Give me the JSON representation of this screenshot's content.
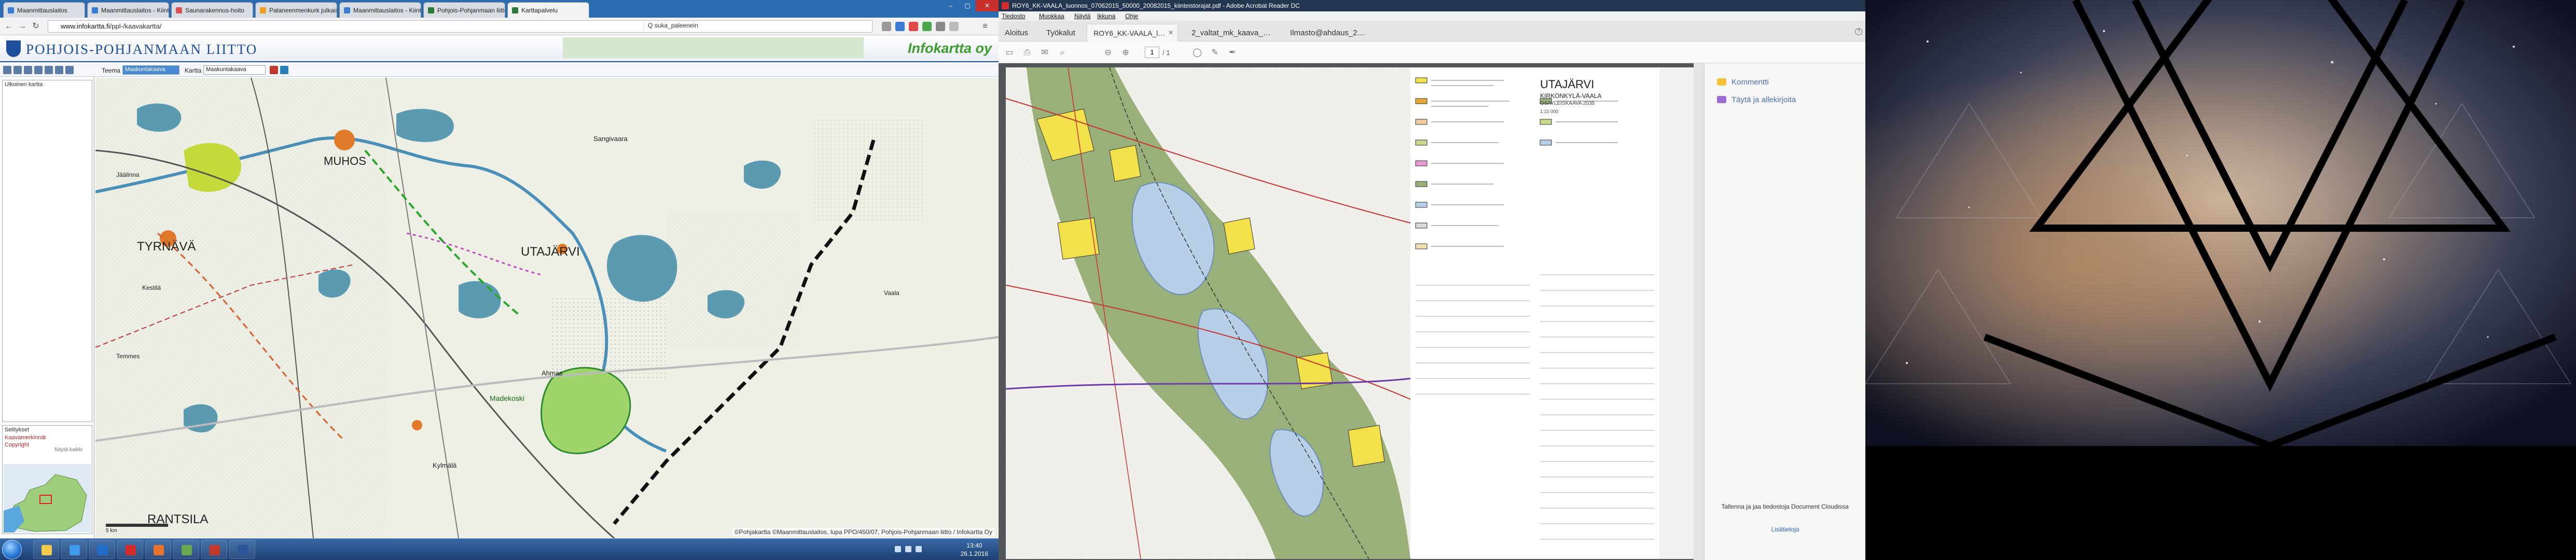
{
  "chrome": {
    "tabs": [
      {
        "label": "Maanmittauslaitos",
        "color": "#3b7bd6"
      },
      {
        "label": "Maanmittauslaitos - Kiinteistötie…",
        "color": "#3b7bd6"
      },
      {
        "label": "Saunarakennus-hoito",
        "color": "#d9534f"
      },
      {
        "label": "Palaneenmenkurk julkaisuo…",
        "color": "#f0a020"
      },
      {
        "label": "Maanmittauslaitos - Kiinteistötie…",
        "color": "#3b7bd6"
      },
      {
        "label": "Pohjois-Pohjanmaan liitto",
        "color": "#2a7a3a"
      },
      {
        "label": "Karttapalvelu",
        "color": "#2a7a3a"
      }
    ],
    "window_buttons": [
      "–",
      "▢",
      "✕"
    ],
    "url_host": "www.infokartta.fi",
    "url_path": "/ppl-/kaavakartta/",
    "search_text": "Q suka_paleenein"
  },
  "mapapp": {
    "title": "POHJOIS-POHJANMAAN LIITTO",
    "brand": "Infokartta oy",
    "tools": {
      "teema_label": "Teema",
      "teema_value": "Maakuntakaava",
      "kartta_label": "Kartta",
      "kartta_value": "Maakuntakaava"
    },
    "left_panel": {
      "box1_title": "Ulkoinen kartta",
      "box2_title": "Selitykset",
      "legend": [
        "Kaavamerkinnät",
        "Copyright"
      ],
      "legend_small": "Näytä kaikki"
    },
    "map_labels": {
      "muhos": "MUHOS",
      "tyrnava": "TYRNÄVÄ",
      "utajarvi": "UTAJÄRVI",
      "rantsila": "RANTSILA",
      "jaasaikka": "Jäälinna",
      "kylmala": "Kylmälä",
      "sangivaara": "Sangivaara",
      "ahmas": "Ahmas",
      "kestila": "Kestilä",
      "temmes": "Temmes",
      "madekoski": "Madekoski",
      "vaala": "Vaala"
    },
    "copyright": "©Pohjakartta ©Maanmittauslaitos, lupa PPO/450/07, Pohjois-Pohjanmaan liitto / Infokartta Oy",
    "scale_label": "5 km"
  },
  "acrobat": {
    "title": "ROY6_KK-VAALA_luonnos_07062015_50000_20082015_kiinteistorajat.pdf - Adobe Acrobat Reader DC",
    "menu": [
      "Tiedosto",
      "Muokkaa",
      "Näytä",
      "Ikkuna",
      "Ohje"
    ],
    "tabs": [
      "Aloitus",
      "Työkalut"
    ],
    "doc_tabs": [
      "ROY6_KK-VAALA_l…",
      "2_valtat_mk_kaava_…",
      "Ilmasto@ahdaus_2…"
    ],
    "page_current": "1",
    "page_total": "/ 1",
    "pdf_title": "UTAJÄRVI",
    "pdf_subtitle": "KIRKONKYLÄ-VAALA",
    "pdf_sub2": "OSAYLEISKAAVA 2035",
    "pdf_scale": "1:10 000",
    "right_pane": {
      "comment": "Kommentti",
      "fill_sign": "Täytä ja allekirjoita",
      "promo": "Tallenna ja jaa tiedostoja Document Cloudissa",
      "link": "Lisätietoja"
    }
  },
  "taskbar": {
    "time": "13:40",
    "date": "26.1.2016",
    "apps": [
      {
        "name": "explorer",
        "color": "#f2c94c"
      },
      {
        "name": "ie",
        "color": "#3d9be9"
      },
      {
        "name": "outlook",
        "color": "#1f6fc9"
      },
      {
        "name": "acrobat",
        "color": "#d42b2b"
      },
      {
        "name": "firefox",
        "color": "#e8732a"
      },
      {
        "name": "paint",
        "color": "#6aa84f"
      },
      {
        "name": "acrobat2",
        "color": "#c0392b"
      },
      {
        "name": "word",
        "color": "#2b579a"
      }
    ]
  }
}
